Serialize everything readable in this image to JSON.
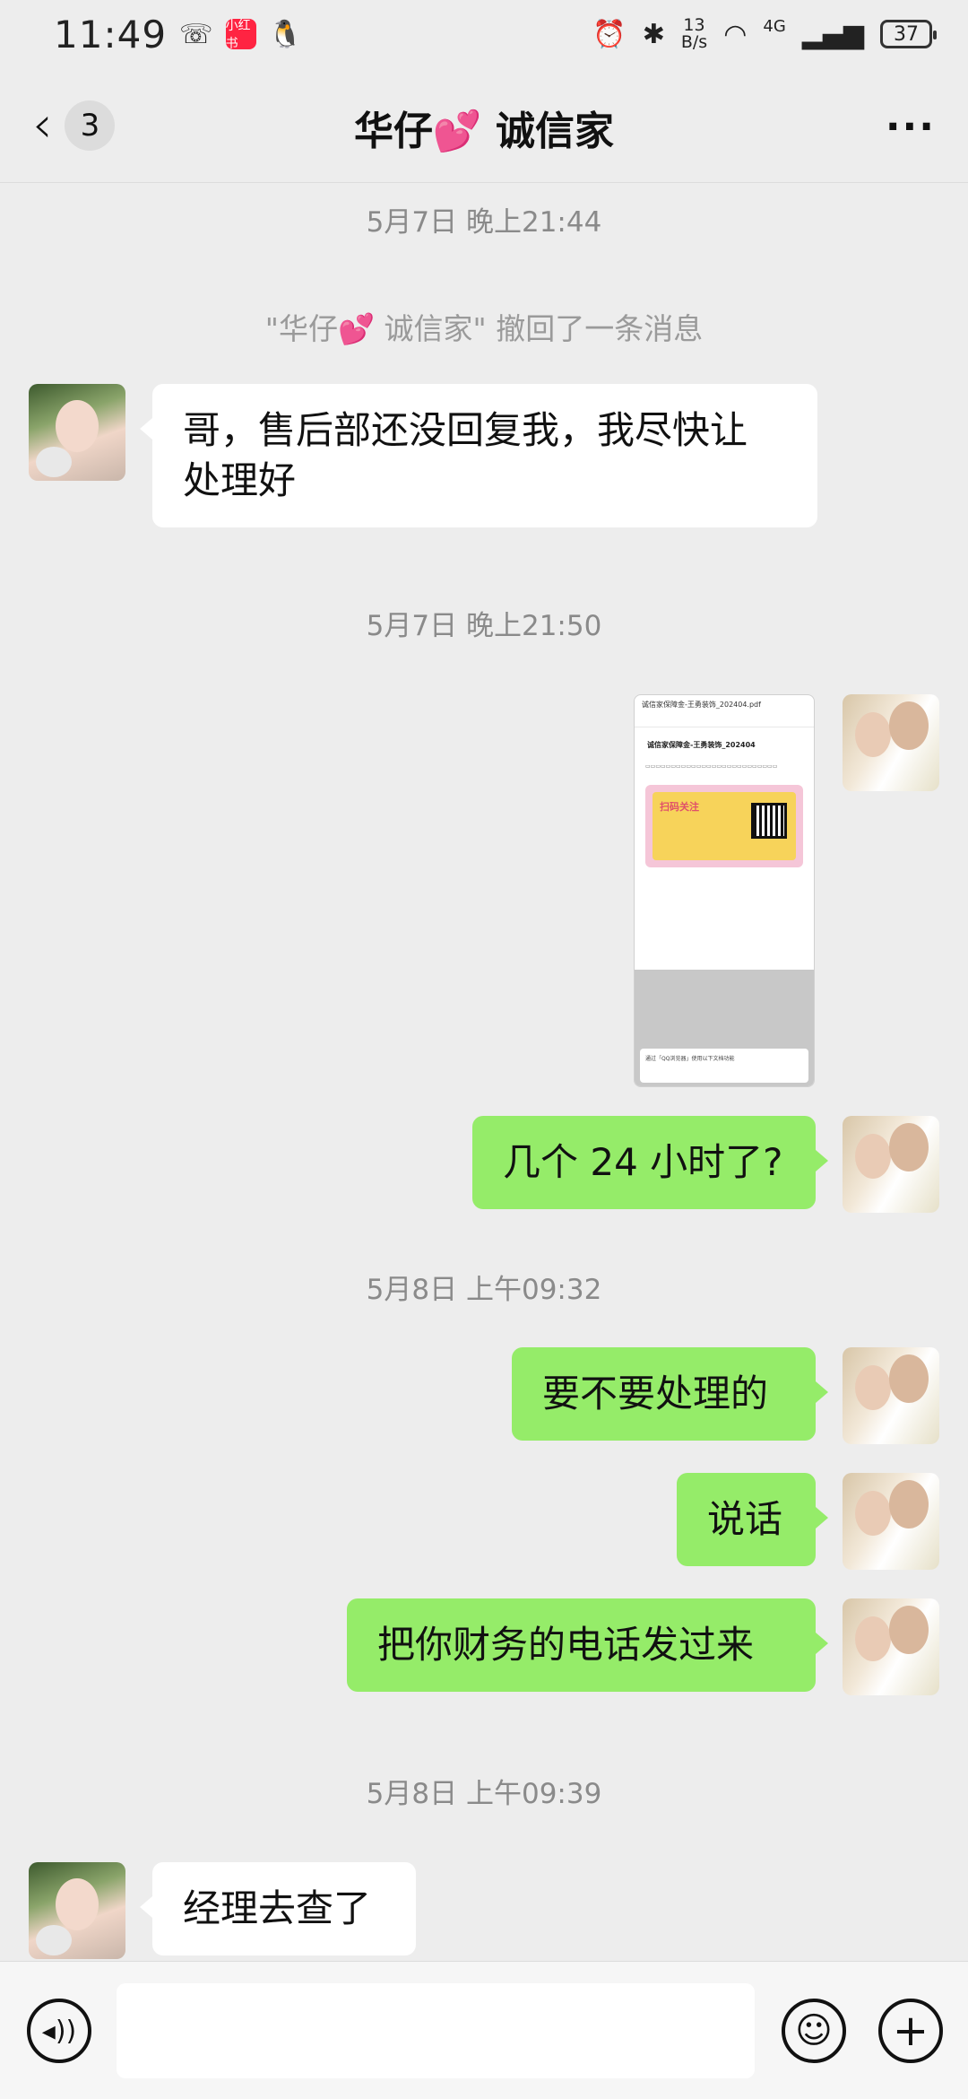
{
  "status_bar": {
    "time": "11:49",
    "app_badge": "小红书",
    "net_speed_value": "13",
    "net_speed_unit": "B/s",
    "network": "4G",
    "battery": "37"
  },
  "header": {
    "back_count": "3",
    "title": "华仔💕 诚信家"
  },
  "messages": {
    "ts1": "5月7日 晚上21:44",
    "recall": "\"华仔💕 诚信家\" 撤回了一条消息",
    "in1_line1": "哥，售后部还没回复我，我尽快让",
    "in1_line2": "处理好",
    "ts2": "5月7日 晚上21:50",
    "shot": {
      "file_title": "诚信家保障金-王勇装饰_202404.pdf",
      "doc_title": "诚信家保障金-王勇装饰_202404",
      "card_text": "扫码关注",
      "bar_text": "通过「QQ浏览器」使用以下文档功能"
    },
    "out1": "几个 24 小时了?",
    "ts3": "5月8日 上午09:32",
    "out2": "要不要处理的",
    "out3": "说话",
    "out4": "把你财务的电话发过来",
    "ts4": "5月8日 上午09:39",
    "in2": "经理去查了"
  },
  "icons": {
    "voice": "voice-icon",
    "emoji": "emoji-icon",
    "plus": "plus-icon",
    "more": "more-icon",
    "back": "back-icon"
  },
  "colors": {
    "outgoing_bubble": "#95ec69",
    "incoming_bubble": "#ffffff",
    "background": "#ededed"
  }
}
